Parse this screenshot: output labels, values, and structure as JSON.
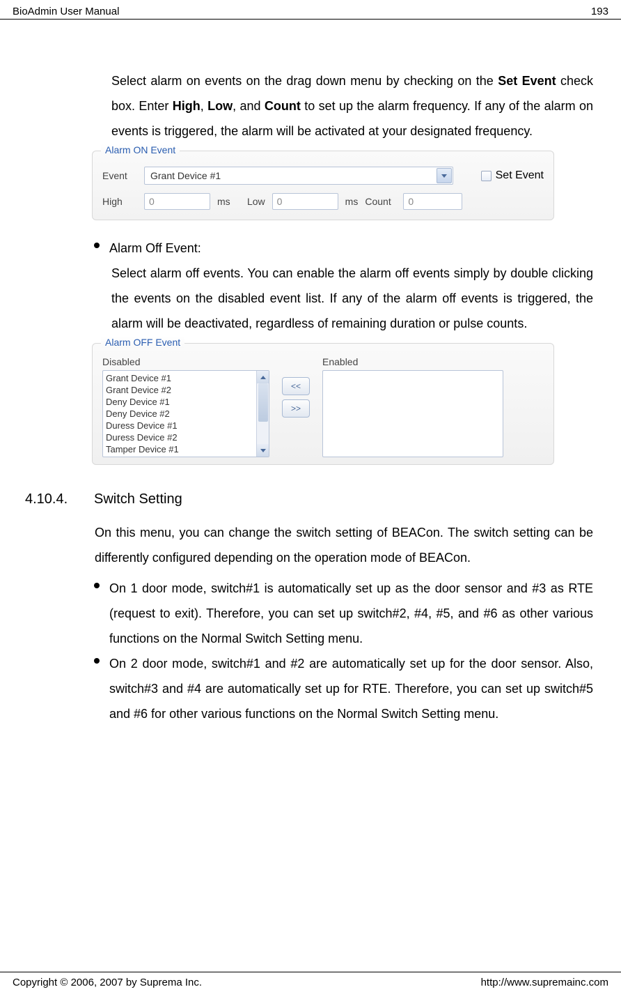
{
  "header": {
    "title": "BioAdmin User Manual",
    "page_number": "193"
  },
  "footer": {
    "copyright": "Copyright © 2006, 2007 by Suprema Inc.",
    "url": "http://www.supremainc.com"
  },
  "para1": {
    "t1": "Select alarm on events on the drag down menu by checking on the ",
    "b1": "Set Event",
    "t2": " check box. Enter ",
    "b2": "High",
    "t3": ", ",
    "b3": "Low",
    "t4": ", and ",
    "b4": "Count",
    "t5": " to set up the alarm frequency. If any of the alarm on events is triggered, the alarm will be activated at your designated frequency."
  },
  "alarm_on": {
    "legend": "Alarm ON Event",
    "event_label": "Event",
    "event_value": "Grant Device #1",
    "set_event_label": "Set Event",
    "high_label": "High",
    "high_value": "0",
    "low_label": "Low",
    "low_value": "0",
    "ms_unit": "ms",
    "count_label": "Count",
    "count_value": "0"
  },
  "bullet_alarm_off": {
    "title": "Alarm Off Event:",
    "body": "Select alarm off events. You can enable the alarm off events simply by double clicking the events on the disabled event list. If any of the alarm off events is triggered, the alarm will be deactivated, regardless of remaining duration or pulse counts."
  },
  "alarm_off": {
    "legend": "Alarm OFF Event",
    "disabled_label": "Disabled",
    "enabled_label": "Enabled",
    "disabled_items": [
      "Grant Device #1",
      "Grant Device #2",
      "Deny Device #1",
      "Deny Device #2",
      "Duress Device #1",
      "Duress Device #2",
      "Tamper Device #1"
    ],
    "btn_left": "<<",
    "btn_right": ">>"
  },
  "section": {
    "number": "4.10.4.",
    "title": "Switch Setting"
  },
  "para2": "On this menu, you can change the switch setting of BEACon. The switch setting can be differently configured depending on the operation mode of BEACon.",
  "bullet1": "On 1 door mode, switch#1 is automatically set up as the door sensor and #3 as RTE (request to exit). Therefore, you can set up switch#2, #4, #5, and #6 as other various functions on the Normal Switch Setting menu.",
  "bullet2": "On 2 door mode, switch#1 and #2 are automatically set up for the door sensor. Also, switch#3 and #4 are automatically set up for RTE. Therefore, you can set up switch#5 and #6 for other various functions on the Normal Switch Setting menu."
}
